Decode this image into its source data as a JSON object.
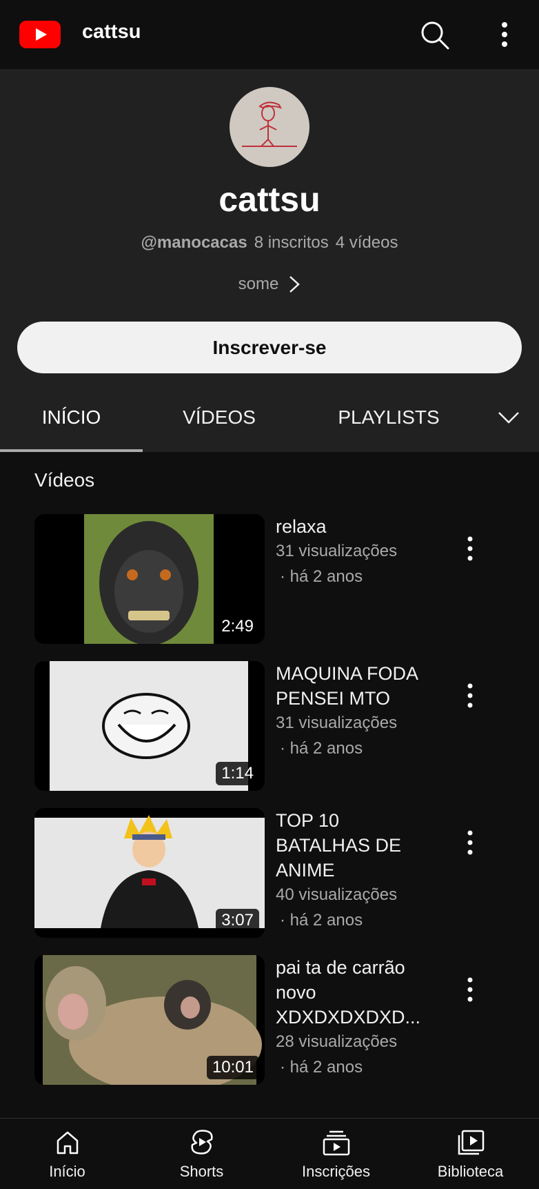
{
  "topbar": {
    "title": "cattsu",
    "logo_icon": "youtube-logo-icon",
    "search_icon": "search-icon",
    "more_icon": "more-vert-icon"
  },
  "channel": {
    "name": "cattsu",
    "handle": "@manocacas",
    "subscribers": "8 inscritos",
    "videos_count": "4 vídeos",
    "description": "some",
    "subscribe_label": "Inscrever-se"
  },
  "tabs": [
    {
      "label": "INÍCIO",
      "active": true
    },
    {
      "label": "VÍDEOS",
      "active": false
    },
    {
      "label": "PLAYLISTS",
      "active": false
    }
  ],
  "section": {
    "title": "Vídeos"
  },
  "videos": [
    {
      "title": "relaxa",
      "views": "31 visualizações",
      "age": "· há 2 anos",
      "duration": "2:49"
    },
    {
      "title": "MAQUINA FODA PENSEI MTO",
      "views": "31 visualizações",
      "age": "· há 2 anos",
      "duration": "1:14"
    },
    {
      "title": "TOP 10 BATALHAS DE ANIME",
      "views": "40 visualizações",
      "age": "· há 2 anos",
      "duration": "3:07"
    },
    {
      "title": "pai ta de carrão novo XDXDXDXDXD...",
      "views": "28 visualizações",
      "age": "· há 2 anos",
      "duration": "10:01"
    }
  ],
  "bottomnav": [
    {
      "label": "Início",
      "icon": "home-icon"
    },
    {
      "label": "Shorts",
      "icon": "shorts-icon"
    },
    {
      "label": "Inscrições",
      "icon": "subscriptions-icon"
    },
    {
      "label": "Biblioteca",
      "icon": "library-icon"
    }
  ],
  "colors": {
    "background": "#0f0f0f",
    "header_bg": "#212121",
    "brand_red": "#ff0000",
    "secondary_text": "#aaaaaa"
  }
}
